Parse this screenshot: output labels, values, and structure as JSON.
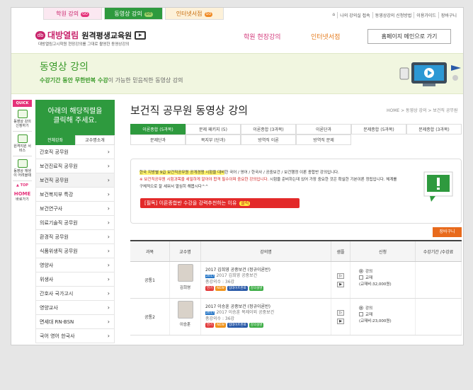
{
  "top_tabs": [
    {
      "label": "학원 강의",
      "go": "GO"
    },
    {
      "label": "동영상 강의",
      "go": "GO"
    },
    {
      "label": "인터넷서점",
      "go": "GO"
    }
  ],
  "util_links": [
    "나의 강의실 접속",
    "동영상강의 신청방법",
    "이용가이드",
    "장바구니"
  ],
  "logo": {
    "brand": "대방열림",
    "name": "원격평생교육원",
    "tagline": "대방열림고시학원 현장강의를 그대로 촬영한 동영상강의"
  },
  "nav": {
    "academy": "학원 현장강의",
    "bookstore": "인터넷서점",
    "home_button": "홈페이지 메인으로 가기"
  },
  "hero": {
    "title": "동영상 강의",
    "desc_bold": "수강기간 동안 무한반복 수강",
    "desc_rest": "이 가능한 믿음직한 동영상 강의"
  },
  "quick": {
    "header": "QUICK",
    "items": [
      "동영상 강의 신청하기",
      "원격지원 서비스",
      "동영상 재생이 어려울때"
    ],
    "top": "▲ TOP",
    "home": "HOME",
    "home_sub": "바로가기"
  },
  "sidebar": {
    "header_line1": "아래의 해당직렬을",
    "header_line2": "클릭해 주세요.",
    "tabs": [
      "전체강좌",
      "교수명소개"
    ],
    "items": [
      "간호직 공무원",
      "보건진료직 공무원",
      "보건직 공무원",
      "보건복지부 특강",
      "보건연구사",
      "의료기술직 공무원",
      "환경직 공무원",
      "식품위생직 공무원",
      "영양사",
      "위생사",
      "간호사 국가고시",
      "영양교사",
      "면세대 RN-BSN",
      "국어 영어 한국사"
    ]
  },
  "page": {
    "title": "보건직 공무원 동영상 강의",
    "breadcrumb": "HOME > 동영상 강의 > 보건직 공무원"
  },
  "course_tabs": [
    "이론종합 (5과목)",
    "문제 패키지 (5)",
    "이론종합 (3과목)",
    "이론단과",
    "문제종합 (5과목)",
    "문제종합 (3과목)",
    "문제단과",
    "복지부 (단과)",
    "방역직 이론",
    "방역직 문제"
  ],
  "notice": {
    "hl_text": "한국 지방별 9급 보건직공무원 공개경쟁 시험을 대비",
    "line1_rest": "한 국어 / 영어 / 한국사 / 공중보건 / 보건행정 이론 종합반 강의입니다.",
    "line2_red": "※ 보건직공무원 시험과목을 세밀하게 알아야 합격 필수이며 중요한 강의입니다.",
    "line2_rest": " 시험을 준비하는데 있어 가장 중요한 것은 확실한 기본이론 정립입니다. 체계를 구체적으로 잘 세워서 열심히 해봅시다^^",
    "button": "[필독] 이론종합반 수강을 강력추천하는 이유",
    "button_badge": "클릭"
  },
  "cart_button": "장바구니",
  "table": {
    "headers": [
      "과목",
      "교수명",
      "강의명",
      "샘플",
      "신청",
      "수강기간 /수강료"
    ],
    "rows": [
      {
        "category": "공통1",
        "professor": "김희영",
        "title": "2017 김희영 공중보건 (정규이론반)",
        "year_badge": "2017",
        "subtitle": "2017 김희영 공중보건",
        "count": "총강의수 : 36강",
        "tags": [
          "연기",
          "NEW",
          "업데이트완료",
          "강의설명"
        ],
        "opt1": "강의",
        "opt2": "교재",
        "price": "(교재비:32,000원)"
      },
      {
        "category": "공통2",
        "professor": "이승훈",
        "title": "2017 이승훈 공중보건 (정규이론반)",
        "year_badge": "2017",
        "subtitle": "2017 이승훈 복제이외 공중보건",
        "count": "총강의수 : 36강",
        "tags": [
          "연기",
          "NEW",
          "업데이트완료",
          "강의설명"
        ],
        "opt1": "강의",
        "opt2": "교재",
        "price": "(교재비:23,000원)"
      }
    ]
  },
  "colors": {
    "green": "#2e9a3e",
    "pink": "#c8236b",
    "orange": "#e86a1c",
    "red": "#e32a2a"
  }
}
